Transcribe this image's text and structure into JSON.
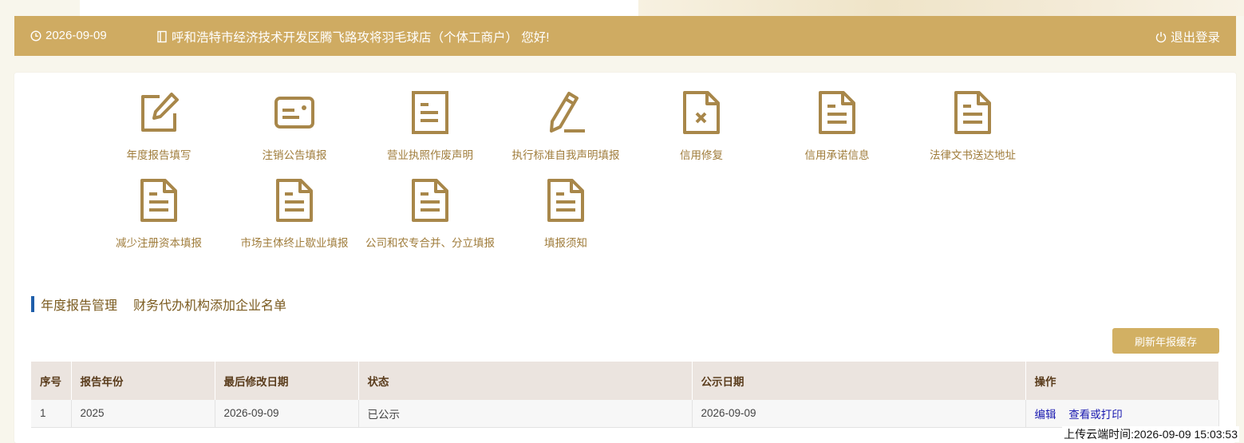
{
  "header": {
    "date": "2026-09-09",
    "greeting": "呼和浩特市经济技术开发区腾飞路攻将羽毛球店（个体工商户） 您好!",
    "logout": "退出登录"
  },
  "tiles": [
    {
      "label": "年度报告填写",
      "icon": "edit-icon"
    },
    {
      "label": "注销公告填报",
      "icon": "card-icon"
    },
    {
      "label": "营业执照作废声明",
      "icon": "document-icon"
    },
    {
      "label": "执行标准自我声明填报",
      "icon": "pen-icon"
    },
    {
      "label": "信用修复",
      "icon": "document-x-icon"
    },
    {
      "label": "信用承诺信息",
      "icon": "document-icon"
    },
    {
      "label": "法律文书送达地址",
      "icon": "document-icon"
    },
    {
      "label": "减少注册资本填报",
      "icon": "document-icon"
    },
    {
      "label": "市场主体终止歇业填报",
      "icon": "document-icon"
    },
    {
      "label": "公司和农专合并、分立填报",
      "icon": "document-icon"
    },
    {
      "label": "填报须知",
      "icon": "document-icon"
    }
  ],
  "section": {
    "tabs": [
      "年度报告管理",
      "财务代办机构添加企业名单"
    ],
    "refresh_button": "刷新年报缓存"
  },
  "table": {
    "headers": [
      "序号",
      "报告年份",
      "最后修改日期",
      "状态",
      "公示日期",
      "操作"
    ],
    "rows": [
      {
        "no": "1",
        "year": "2025",
        "modified": "2026-09-09",
        "status": "已公示",
        "publish_date": "2026-09-09",
        "actions": [
          "编辑",
          "查看或打印"
        ]
      }
    ]
  },
  "footer": {
    "upload_time": "上传云端时间:2026-09-09 15:03:53"
  },
  "colors": {
    "header_bg": "#cfab62",
    "icon_gold": "#a8874a",
    "label_gold": "#a07d3c",
    "section_bar": "#1f5eaa",
    "button_bg": "#d2b063",
    "link_blue": "#1a1ab0"
  }
}
